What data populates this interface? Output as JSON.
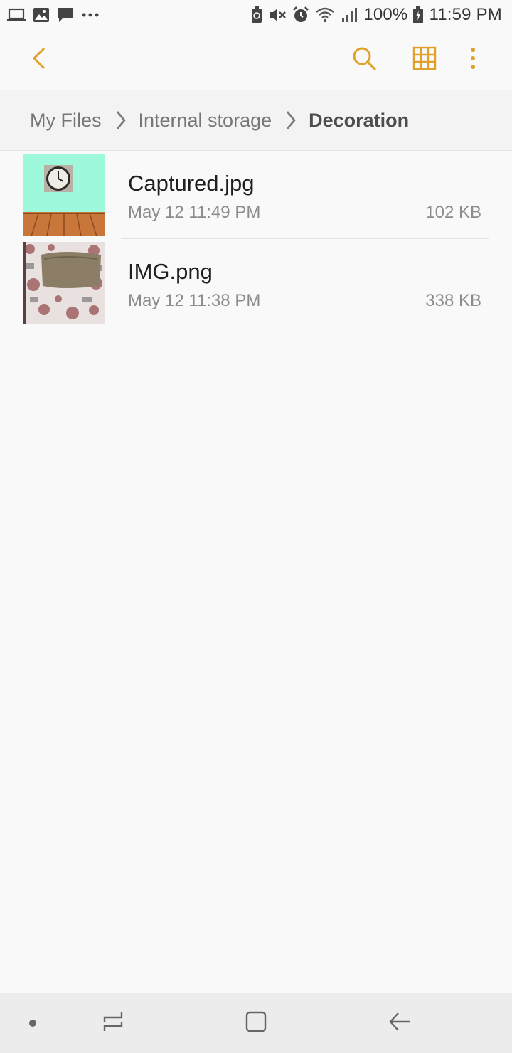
{
  "status_bar": {
    "battery_percent": "100%",
    "time": "11:59 PM",
    "left_icons": [
      "laptop-icon",
      "gallery-icon",
      "message-icon",
      "more-notifications-icon"
    ],
    "right_icons": [
      "battery-saver-icon",
      "mute-icon",
      "alarm-icon",
      "wifi-icon",
      "signal-icon",
      "battery-charging-icon"
    ]
  },
  "toolbar": {
    "back_icon": "chevron-left-icon",
    "search_icon": "search-icon",
    "view_icon": "grid-view-icon",
    "more_icon": "more-vertical-icon",
    "accent_color": "#e0a12a"
  },
  "breadcrumb": {
    "items": [
      "My Files",
      "Internal storage",
      "Decoration"
    ]
  },
  "files": [
    {
      "name": "Captured.jpg",
      "date": "May 12 11:49 PM",
      "size": "102 KB",
      "thumb": "clock-on-wall-thumbnail"
    },
    {
      "name": "IMG.png",
      "date": "May 12 11:38 PM",
      "size": "338 KB",
      "thumb": "sofa-cushion-thumbnail"
    }
  ],
  "nav_bar": {
    "buttons": [
      "dot-indicator",
      "recent-apps-icon",
      "home-icon",
      "back-arrow-icon"
    ]
  }
}
